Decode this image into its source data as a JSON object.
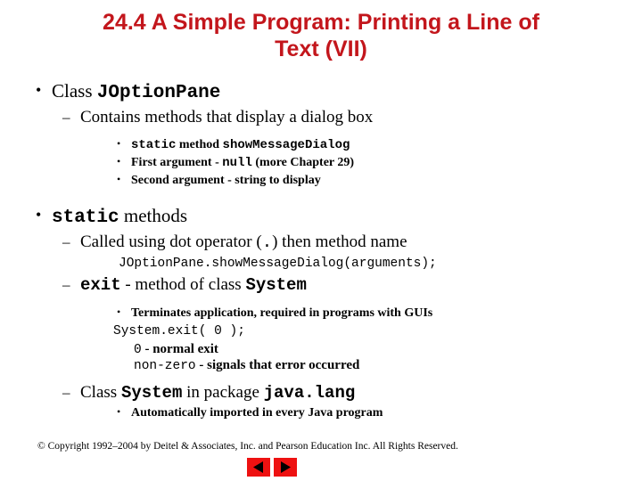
{
  "slide": {
    "title_line1": "24.4  A Simple Program: Printing a Line of",
    "title_line2": "Text (VII)",
    "title_color": "#C3161C"
  },
  "content": {
    "b1_bullet": "•",
    "b1_text_pre": "Class ",
    "b1_code": "JOptionPane",
    "b2_bullet": "–",
    "b2_text": "Contains methods that display a dialog box",
    "b3a_bullet": "•",
    "b3a_code": "static",
    "b3a_mid": " method ",
    "b3a_code2": "showMessageDialog",
    "b3b_bullet": "•",
    "b3b_pre": "First argument - ",
    "b3b_code": "null",
    "b3b_post": " (more Chapter 29)",
    "b3c_bullet": "•",
    "b3c_text": "Second argument - string to display",
    "b4_bullet": "•",
    "b4_code": "static",
    "b4_text": " methods",
    "b5_bullet": "–",
    "b5_pre": "Called using dot operator (",
    "b5_code": ".",
    "b5_post": ") then method name",
    "code1": "JOptionPane.showMessageDialog(arguments);",
    "b6_bullet": "–",
    "b6_code": "exit",
    "b6_text": " - method of class ",
    "b6_code2": "System",
    "b7_bullet": "•",
    "b7_text": "Terminates application, required in programs with GUIs",
    "code2": "System.exit( 0 );",
    "b8_code": "0",
    "b8_text": "  - normal exit",
    "b9_code": "non-zero",
    "b9_text": " - signals that error occurred",
    "b10_bullet": "–",
    "b10_pre": "Class ",
    "b10_code": "System",
    "b10_mid": " in package ",
    "b10_code2": "java.lang",
    "b11_bullet": "•",
    "b11_text": "Automatically imported in every Java program"
  },
  "footer": {
    "copyright": "© Copyright 1992–2004 by Deitel & Associates, Inc. and Pearson Education Inc. All Rights Reserved."
  },
  "nav": {
    "prev_label": "Previous slide",
    "next_label": "Next slide",
    "button_color": "#EE1111",
    "arrow_color": "#000000"
  }
}
